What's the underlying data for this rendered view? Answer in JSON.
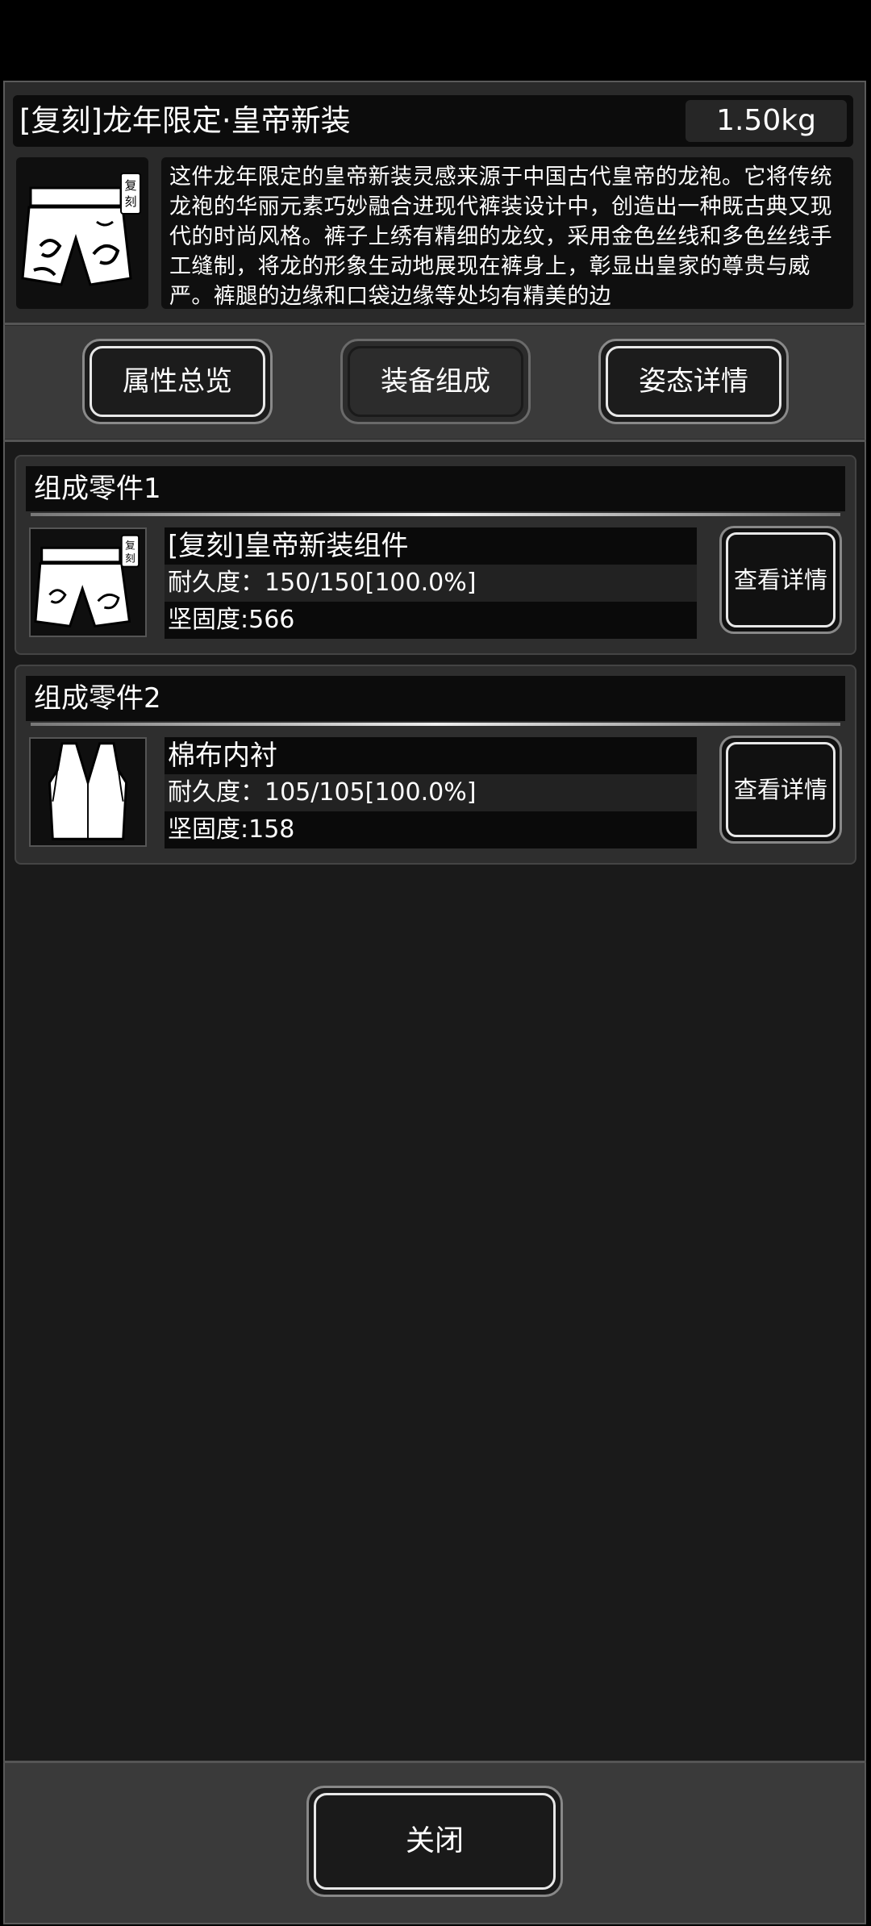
{
  "item": {
    "title": "[复刻]龙年限定·皇帝新装",
    "weight": "1.50kg",
    "icon": "shorts-icon",
    "badge": "复刻",
    "description": "这件龙年限定的皇帝新装灵感来源于中国古代皇帝的龙袍。它将传统龙袍的华丽元素巧妙融合进现代裤装设计中，创造出一种既古典又现代的时尚风格。裤子上绣有精细的龙纹，采用金色丝线和多色丝线手工缝制，将龙的形象生动地展现在裤身上，彰显出皇家的尊贵与威严。裤腿的边缘和口袋边缘等处均有精美的边"
  },
  "tabs": [
    {
      "label": "属性总览",
      "active": false
    },
    {
      "label": "装备组成",
      "active": true
    },
    {
      "label": "姿态详情",
      "active": false
    }
  ],
  "parts": [
    {
      "header": "组成零件1",
      "name": "[复刻]皇帝新装组件",
      "durability": "耐久度：150/150[100.0%]",
      "hardness": "坚固度:566",
      "icon": "shorts-icon",
      "badge": "复刻",
      "button": "查看详情"
    },
    {
      "header": "组成零件2",
      "name": "棉布内衬",
      "durability": "耐久度：105/105[100.0%]",
      "hardness": "坚固度:158",
      "icon": "vest-icon",
      "button": "查看详情"
    }
  ],
  "footer": {
    "close_label": "关闭"
  }
}
